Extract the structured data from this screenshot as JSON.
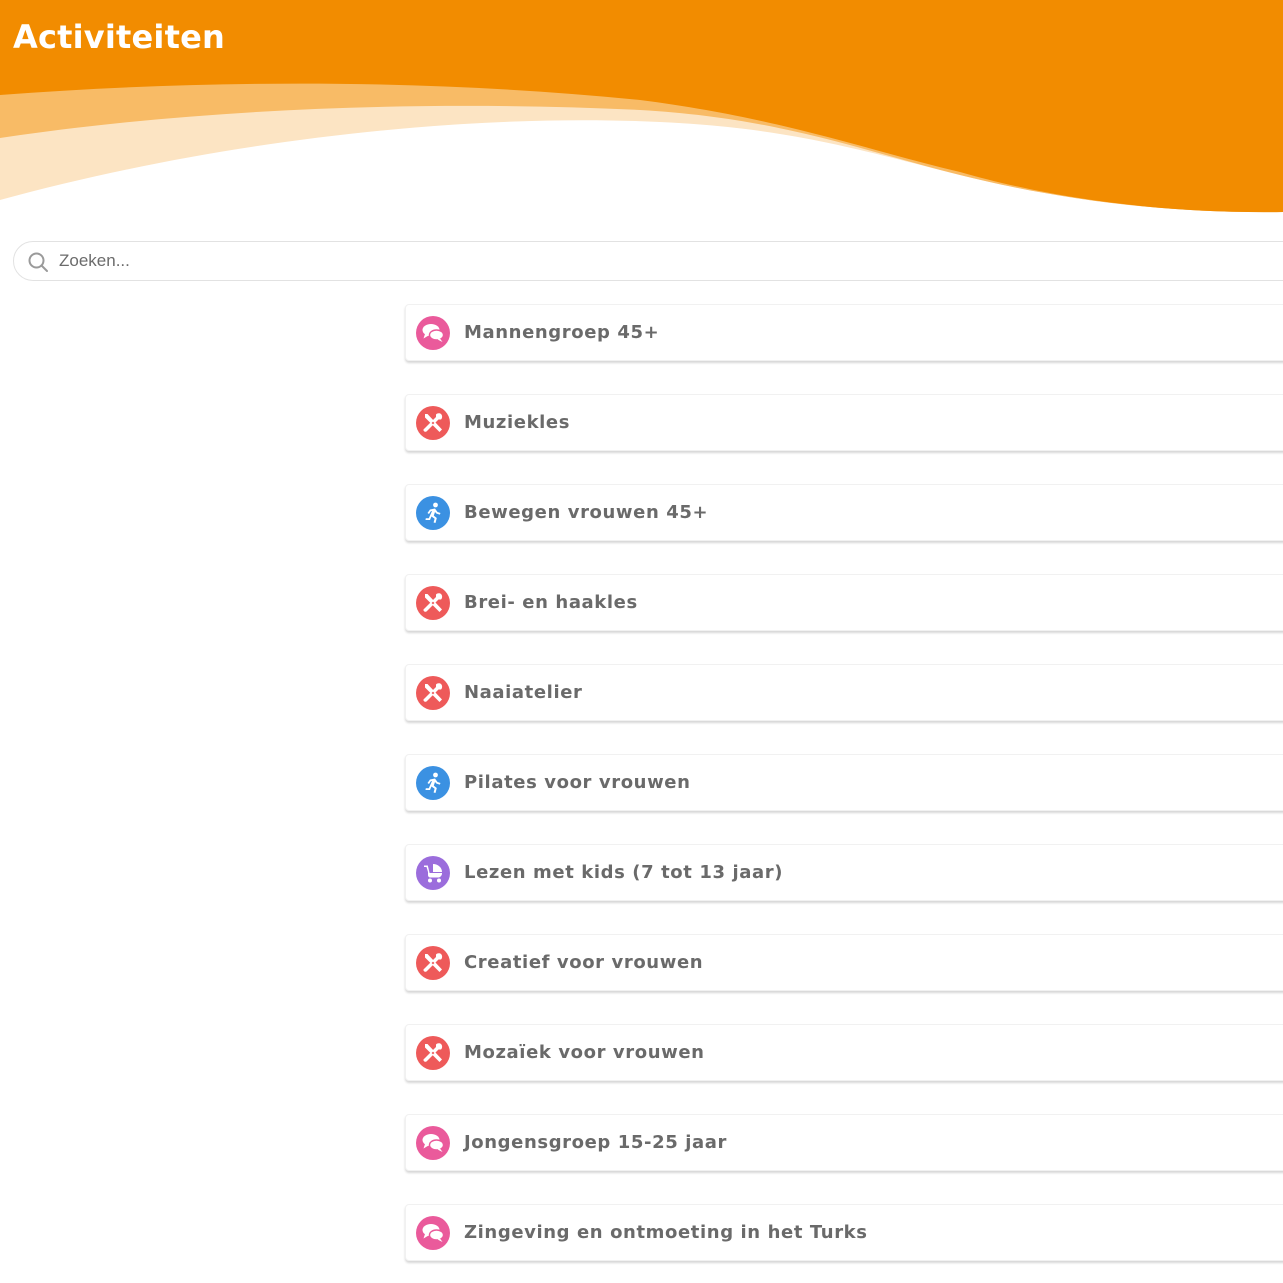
{
  "header": {
    "title": "Activiteiten",
    "color_primary": "#f28c00",
    "color_light_1": "#f8bb66",
    "color_light_2": "#fce4c3"
  },
  "search": {
    "placeholder": "Zoeken...",
    "value": "",
    "icon": "search-icon"
  },
  "activities": [
    {
      "label": "Mannengroep 45+",
      "icon": "chat-icon",
      "color": "#ea5a9b"
    },
    {
      "label": "Muziekles",
      "icon": "tools-icon",
      "color": "#ee5a5a"
    },
    {
      "label": "Bewegen vrouwen 45+",
      "icon": "running-icon",
      "color": "#3b91e2"
    },
    {
      "label": "Brei- en haakles",
      "icon": "tools-icon",
      "color": "#ee5a5a"
    },
    {
      "label": "Naaiatelier",
      "icon": "tools-icon",
      "color": "#ee5a5a"
    },
    {
      "label": "Pilates voor vrouwen",
      "icon": "running-icon",
      "color": "#3b91e2"
    },
    {
      "label": "Lezen met kids (7 tot 13 jaar)",
      "icon": "stroller-icon",
      "color": "#9b6ddc"
    },
    {
      "label": "Creatief voor vrouwen",
      "icon": "tools-icon",
      "color": "#ee5a5a"
    },
    {
      "label": "Mozaïek voor vrouwen",
      "icon": "tools-icon",
      "color": "#ee5a5a"
    },
    {
      "label": "Jongensgroep 15-25 jaar",
      "icon": "chat-icon",
      "color": "#ea5a9b"
    },
    {
      "label": "Zingeving en ontmoeting in het Turks",
      "icon": "chat-icon",
      "color": "#ea5a9b"
    }
  ]
}
